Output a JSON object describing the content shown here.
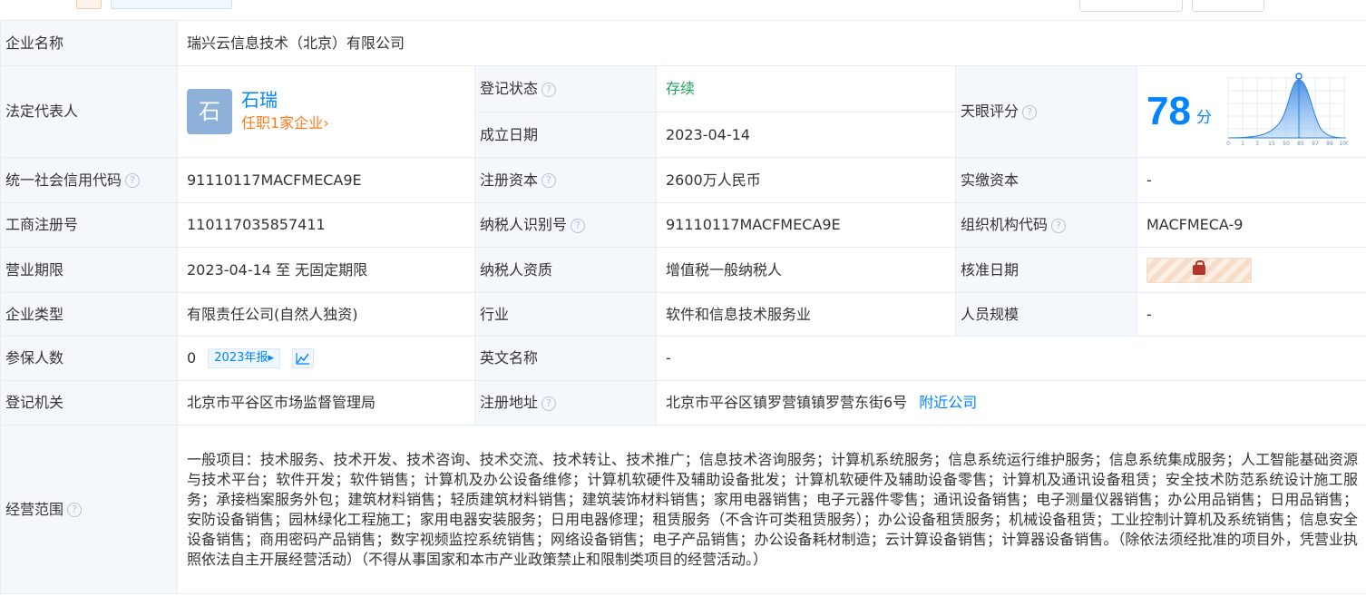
{
  "header": {
    "btn1_label": "",
    "btn2_label": "",
    "brand_label": ""
  },
  "labels": {
    "company_name": "企业名称",
    "legal_rep": "法定代表人",
    "reg_status": "登记状态",
    "established": "成立日期",
    "score": "天眼评分",
    "credit_code": "统一社会信用代码",
    "reg_capital": "注册资本",
    "paid_capital": "实缴资本",
    "biz_reg_no": "工商注册号",
    "taxpayer_id": "纳税人识别号",
    "org_code": "组织机构代码",
    "biz_term": "营业期限",
    "taxpayer_qual": "纳税人资质",
    "approve_date": "核准日期",
    "company_type": "企业类型",
    "industry": "行业",
    "staff_size": "人员规模",
    "insured": "参保人数",
    "english_name": "英文名称",
    "reg_authority": "登记机关",
    "reg_address": "注册地址",
    "biz_scope": "经营范围"
  },
  "values": {
    "company_name": "瑞兴云信息技术（北京）有限公司",
    "legal_avatar": "石",
    "legal_name": "石瑞",
    "legal_positions": "任职1家企业",
    "reg_status": "存续",
    "established": "2023-04-14",
    "score": "78",
    "score_unit": "分",
    "credit_code": "91110117MACFMECA9E",
    "reg_capital": "2600万人民币",
    "paid_capital": "-",
    "biz_reg_no": "110117035857411",
    "taxpayer_id": "91110117MACFMECA9E",
    "org_code": "MACFMECA-9",
    "biz_term": "2023-04-14 至 无固定期限",
    "taxpayer_qual": "增值税一般纳税人",
    "company_type": "有限责任公司(自然人独资)",
    "industry": "软件和信息技术服务业",
    "staff_size": "-",
    "insured": "0",
    "insured_report": "2023年报",
    "english_name": "-",
    "reg_authority": "北京市平谷区市场监督管理局",
    "reg_address": "北京市平谷区镇罗营镇镇罗营东街6号",
    "nearby_link": "附近公司",
    "biz_scope": "一般项目：技术服务、技术开发、技术咨询、技术交流、技术转让、技术推广；信息技术咨询服务；计算机系统服务；信息系统运行维护服务；信息系统集成服务；人工智能基础资源与技术平台；软件开发；软件销售；计算机及办公设备维修；计算机软硬件及辅助设备批发；计算机软硬件及辅助设备零售；计算机及通讯设备租赁；安全技术防范系统设计施工服务；承接档案服务外包；建筑材料销售；轻质建筑材料销售；建筑装饰材料销售；家用电器销售；电子元器件零售；通讯设备销售；电子测量仪器销售；办公用品销售；日用品销售；安防设备销售；园林绿化工程施工；家用电器安装服务；日用电器修理；租赁服务（不含许可类租赁服务）；办公设备租赁服务；机械设备租赁；工业控制计算机及系统销售；信息安全设备销售；商用密码产品销售；数字视频监控系统销售；网络设备销售；电子产品销售；办公设备耗材制造；云计算设备销售；计算器设备销售。（除依法须经批准的项目外，凭营业执照依法自主开展经营活动）（不得从事国家和本市产业政策禁止和限制类项目的经营活动。）"
  },
  "score_chart": {
    "x_ticks": [
      "0",
      "1",
      "3",
      "15",
      "50",
      "85",
      "97",
      "99",
      "100"
    ],
    "marker_value": 78
  },
  "icons": {
    "help": "?",
    "chevron": "›",
    "triangle": "▸"
  },
  "colors": {
    "accent": "#0084ff",
    "status_green": "#1aa55e",
    "orange": "#ff7a1a",
    "label_bg": "#f4f8fd",
    "border": "#e6edf5"
  }
}
